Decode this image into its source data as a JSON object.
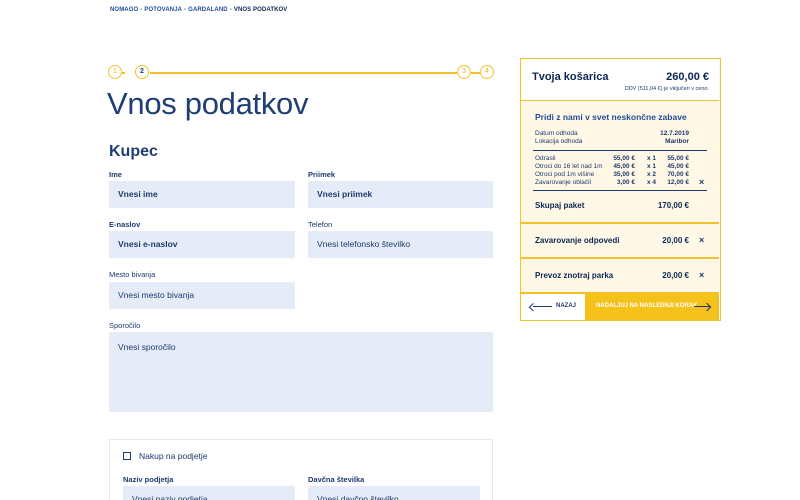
{
  "breadcrumb": {
    "items": [
      "NOMAGO",
      "POTOVANJA",
      "GARDALAND"
    ],
    "current": "VNOS PODATKOV",
    "separator": "-"
  },
  "stepper": {
    "steps": [
      "1",
      "2",
      "3",
      "4"
    ],
    "active_step": 2
  },
  "page": {
    "title": "Vnos podatkov",
    "section_title": "Kupec"
  },
  "form": {
    "first_name": {
      "label": "Ime",
      "placeholder": "Vnesi ime"
    },
    "last_name": {
      "label": "Priimek",
      "placeholder": "Vnesi priimek"
    },
    "email": {
      "label": "E-naslov",
      "placeholder": "Vnesi e-naslov"
    },
    "phone": {
      "label": "Telefon",
      "placeholder": "Vnesi telefonsko številko"
    },
    "city": {
      "label": "Mesto bivanja",
      "placeholder": "Vnesi mesto bivanja"
    },
    "message": {
      "label": "Sporočilo",
      "placeholder": "Vnesi sporočilo"
    },
    "company": {
      "checkbox_label": "Nakup na podjetje",
      "name": {
        "label": "Naziv podjetja",
        "placeholder": "Vnesi naziv podjetja"
      },
      "tax": {
        "label": "Davčna številka",
        "placeholder": "Vnesi davčno številko"
      }
    }
  },
  "cart": {
    "title": "Tvoja košarica",
    "total": "260,00 €",
    "vat_note": "DDV (511,04 €) je vključen v ceno.",
    "package": {
      "title": "Pridi z nami v svet neskončne zabave",
      "departure_date_label": "Datum odhoda",
      "departure_date": "12.7.2019",
      "departure_location_label": "Lokacija odhoda",
      "departure_location": "Maribor",
      "items": [
        {
          "name": "Odrasli",
          "price": "55,00 €",
          "qty": "x 1",
          "total": "55,00 €",
          "removable": false
        },
        {
          "name": "Otroci do 16 let nad 1m",
          "price": "45,00 €",
          "qty": "x 1",
          "total": "45,00 €",
          "removable": false
        },
        {
          "name": "Otroci pod 1m višine",
          "price": "35,00 €",
          "qty": "x 2",
          "total": "70,00 €",
          "removable": false
        },
        {
          "name": "Zavarovanje oblačil",
          "price": "3,00 €",
          "qty": "x 4",
          "total": "12,00 €",
          "removable": true
        }
      ],
      "subtotal_label": "Skupaj paket",
      "subtotal": "170,00 €"
    },
    "extras": [
      {
        "label": "Zavarovanje odpovedi",
        "price": "20,00 €"
      },
      {
        "label": "Prevoz znotraj parka",
        "price": "20,00 €"
      }
    ],
    "remove_glyph": "×",
    "back_label": "NAZAJ",
    "next_label": "NADALJUJ NA NASLEDNJI KORAK"
  },
  "colors": {
    "accent_yellow": "#f2c12e",
    "navy": "#1d3a6e",
    "field_bg": "#e6ecf7",
    "cart_bg": "#fff8e6"
  }
}
